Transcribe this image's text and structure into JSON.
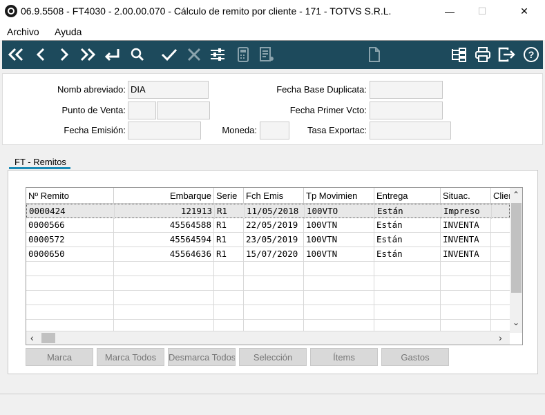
{
  "window": {
    "title": "06.9.5508 - FT4030 - 2.00.00.070 - Cálculo de remito por cliente - 171 - TOTVS S.R.L.",
    "min_glyph": "—",
    "max_glyph": "☐",
    "close_glyph": "✕"
  },
  "menu": {
    "items": [
      "Archivo",
      "Ayuda"
    ]
  },
  "toolbar": {
    "background": "#1d4a5c",
    "icons": [
      "first-icon",
      "previous-icon",
      "next-icon",
      "last-icon",
      "return-icon",
      "search-icon",
      "confirm-icon",
      "cancel-icon",
      "filter-icon",
      "calculator-icon",
      "report-icon",
      "document-icon",
      "tree-icon",
      "print-icon",
      "exit-icon",
      "help-icon"
    ]
  },
  "header_form": {
    "nomb_abreviado_label": "Nomb abreviado:",
    "nomb_abreviado_value": "DIA",
    "punto_venta_label": "Punto de Venta:",
    "punto_venta_value_1": "",
    "punto_venta_value_2": "",
    "fecha_emision_label": "Fecha Emisión:",
    "fecha_emision_value": "",
    "moneda_label": "Moneda:",
    "moneda_value": "",
    "fecha_base_label": "Fecha Base Duplicata:",
    "fecha_base_value": "",
    "fecha_vcto_label": "Fecha Primer Vcto:",
    "fecha_vcto_value": "",
    "tasa_label": "Tasa Exportac:",
    "tasa_value": ""
  },
  "tabs": [
    {
      "label": "FT - Remitos",
      "active": true
    }
  ],
  "grid": {
    "columns": [
      "Nº Remito",
      "Embarque",
      "Serie",
      "Fch Emis",
      "Tp Movimien",
      "Entrega",
      "Situac.",
      "Clier"
    ],
    "rows": [
      [
        "0000424",
        "121913",
        "R1",
        "11/05/2018",
        "100VTO",
        "Están",
        "Impreso",
        ""
      ],
      [
        "0000566",
        "45564588",
        "R1",
        "22/05/2019",
        "100VTN",
        "Están",
        "INVENTA",
        ""
      ],
      [
        "0000572",
        "45564594",
        "R1",
        "23/05/2019",
        "100VTN",
        "Están",
        "INVENTA",
        ""
      ],
      [
        "0000650",
        "45564636",
        "R1",
        "15/07/2020",
        "100VTN",
        "Están",
        "INVENTA",
        ""
      ]
    ],
    "selected_row": 0,
    "scroll_up": "⌃",
    "scroll_down": "⌄",
    "scroll_left": "‹",
    "scroll_right": "›"
  },
  "buttons": {
    "marca": "Marca",
    "marca_todos": "Marca Todos",
    "desmarca_todos": "Desmarca Todos",
    "seleccion": "Selección",
    "items": "Ítems",
    "gastos": "Gastos"
  }
}
